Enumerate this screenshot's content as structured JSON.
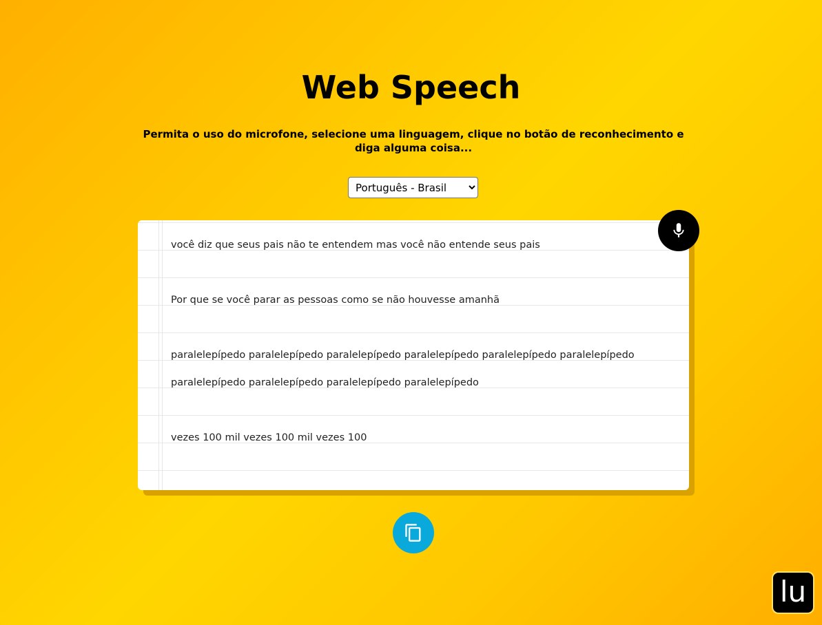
{
  "header": {
    "title": "Web Speech",
    "instructions": "Permita o uso do microfone, selecione uma linguagem, clique no botão de reconhecimento e diga alguma coisa..."
  },
  "language_select": {
    "selected": "Português - Brasil"
  },
  "transcript": {
    "lines": [
      "você diz que seus pais não te entendem mas você não entende seus pais",
      "",
      "Por que se você parar as pessoas como se não houvesse amanhã",
      "",
      "paralelepípedo paralelepípedo paralelepípedo paralelepípedo paralelepípedo paralelepípedo",
      "paralelepípedo paralelepípedo paralelepípedo paralelepípedo",
      "",
      "vezes 100 mil vezes 100 mil vezes 100"
    ]
  },
  "buttons": {
    "mic_icon": "microphone-icon",
    "copy_icon": "copy-icon"
  },
  "logo": {
    "text": "lu"
  },
  "colors": {
    "mic_button": "#000000",
    "copy_button": "#0aa9dc",
    "background_start": "#ffb000",
    "background_mid": "#ffd600"
  }
}
